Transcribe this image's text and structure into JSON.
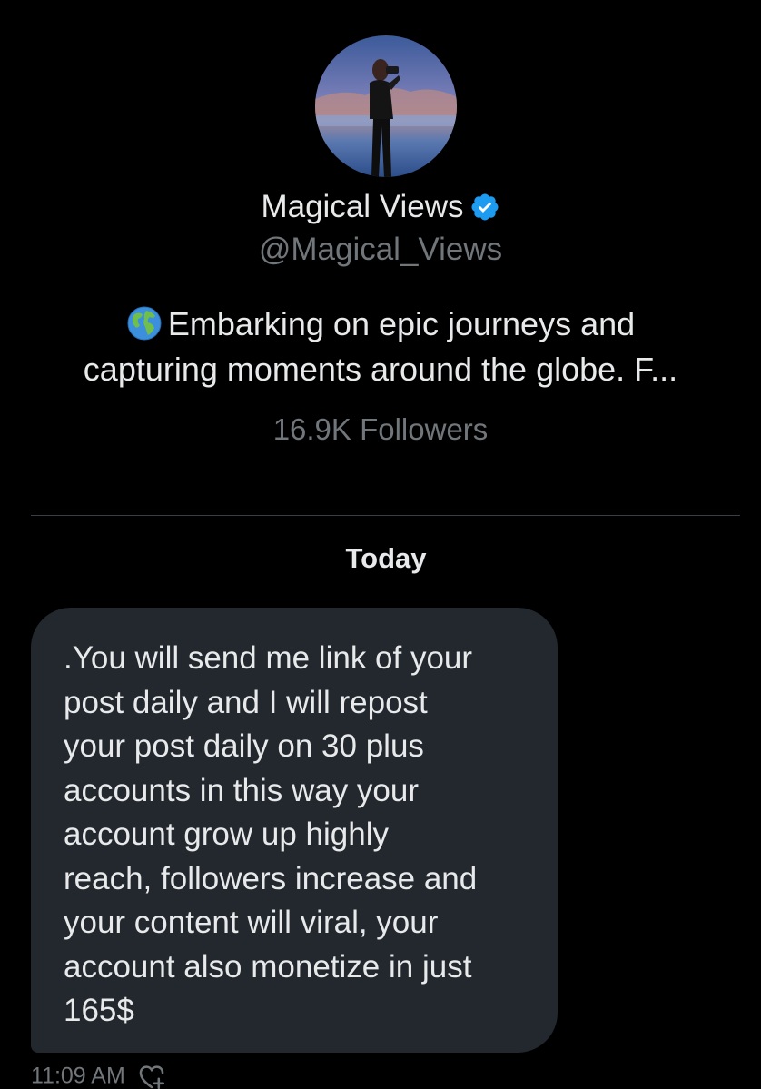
{
  "profile": {
    "display_name": "Magical Views",
    "handle": "@Magical_Views",
    "bio_line1": "Embarking on epic journeys and",
    "bio_line2": "capturing moments around the globe. F...",
    "followers": "16.9K Followers",
    "verified_color": "#1d9bf0"
  },
  "conversation": {
    "date_label": "Today",
    "message_lines": [
      ".You will send me link of your",
      "post daily and I will repost",
      "your post daily on 30 plus",
      "accounts in this way your",
      "account grow up highly",
      "reach, followers increase and",
      "your content will viral, your",
      "account also monetize in just",
      "165$"
    ],
    "timestamp": "11:09 AM"
  },
  "icons": {
    "verified": "verified-badge-icon",
    "globe": "globe-emoji-icon",
    "reaction": "heart-add-icon"
  },
  "theme": {
    "background": "#000000",
    "bubble": "#22282e",
    "primary_text": "#e7e9ea",
    "secondary_text": "#71767b"
  }
}
